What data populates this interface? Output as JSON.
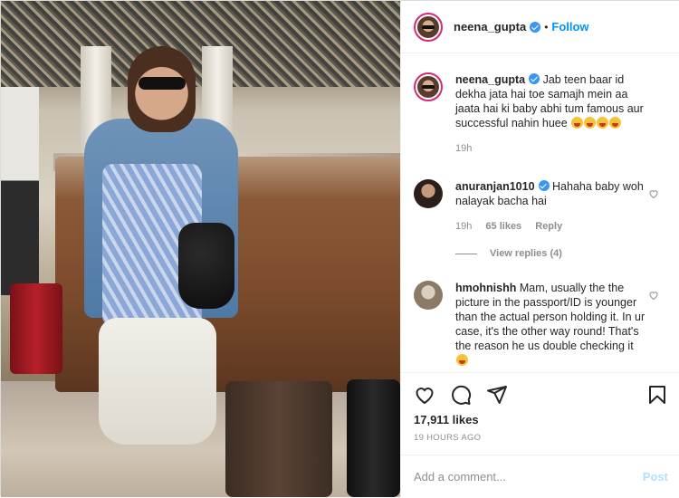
{
  "post": {
    "username": "neena_gupta",
    "follow_label": "Follow",
    "likes": "17,911 likes",
    "time_ago": "19 HOURS AGO",
    "separator": "•"
  },
  "caption": {
    "username": "neena_gupta",
    "text": "Jab teen baar id dekha jata hai toe samajh mein aa jaata hai ki baby abhi tum famous aur successful nahin huee",
    "time": "19h"
  },
  "comments": [
    {
      "username": "anuranjan1010",
      "text": "Hahaha baby woh nalayak bacha hai",
      "time": "19h",
      "likes": "65 likes",
      "reply_label": "Reply",
      "view_replies": "View replies (4)"
    },
    {
      "username": "hmohnishh",
      "text": "Mam, usually the the picture in the passport/ID is younger than the actual person holding it. In ur case, it's the other way round! That's the reason he us double checking it"
    }
  ],
  "add_comment": {
    "placeholder": "Add a comment...",
    "post_label": "Post"
  },
  "colors": {
    "accent": "#0095f6",
    "verified": "#3897f0",
    "post_disabled": "#b2dffc",
    "muted": "#8e8e8e"
  },
  "icons": [
    "heart-icon",
    "comment-icon",
    "share-icon",
    "bookmark-icon",
    "verified-icon"
  ]
}
